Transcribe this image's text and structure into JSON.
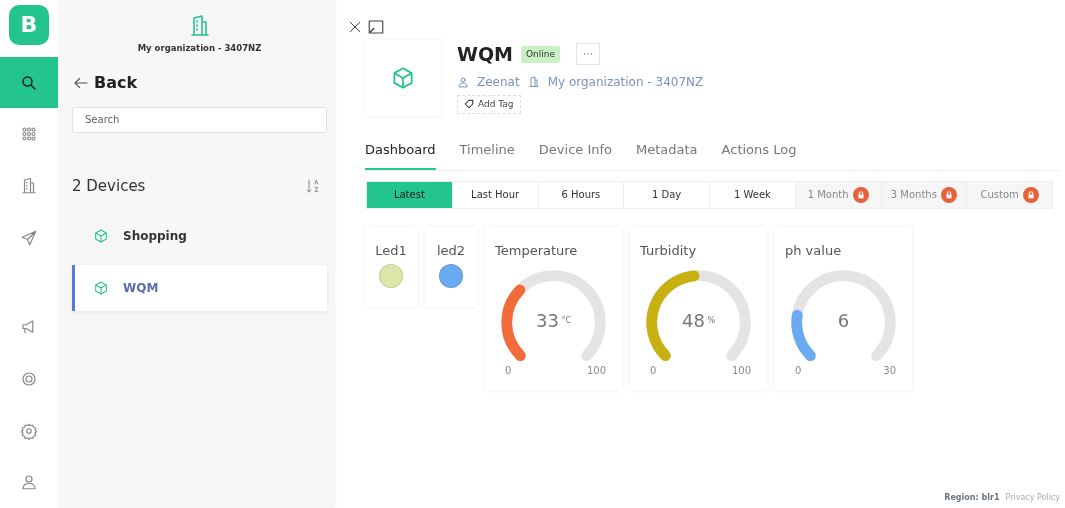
{
  "logo": {
    "letter": "B"
  },
  "rail": [
    {
      "kind": "search",
      "selected": true
    },
    {
      "kind": "grid",
      "selected": false
    },
    {
      "kind": "building",
      "selected": false
    },
    {
      "kind": "send",
      "selected": false
    },
    {
      "kind": "megaphone",
      "selected": false
    },
    {
      "kind": "lifebuoy",
      "selected": false
    },
    {
      "kind": "gear",
      "selected": false
    },
    {
      "kind": "user",
      "selected": false
    }
  ],
  "sidebar": {
    "organization": "My organization - 3407NZ",
    "back": "Back",
    "search": {
      "placeholder": "Search"
    },
    "count": "2 Devices",
    "devices": [
      {
        "name": "Shopping",
        "selected": false
      },
      {
        "name": "WQM",
        "selected": true
      }
    ]
  },
  "device": {
    "name": "WQM",
    "status": "Online",
    "online": true,
    "owner": "Zeenat",
    "organization": "My organization - 3407NZ",
    "add_tag": "Add Tag"
  },
  "tabs": [
    {
      "label": "Dashboard",
      "selected": true
    },
    {
      "label": "Timeline",
      "selected": false
    },
    {
      "label": "Device Info",
      "selected": false
    },
    {
      "label": "Metadata",
      "selected": false
    },
    {
      "label": "Actions Log",
      "selected": false
    }
  ],
  "ranges": [
    {
      "label": "Latest",
      "selected": true,
      "locked": false
    },
    {
      "label": "Last Hour",
      "selected": false,
      "locked": false
    },
    {
      "label": "6 Hours",
      "selected": false,
      "locked": false
    },
    {
      "label": "1 Day",
      "selected": false,
      "locked": false
    },
    {
      "label": "1 Week",
      "selected": false,
      "locked": false
    },
    {
      "label": "1 Month",
      "selected": false,
      "locked": true
    },
    {
      "label": "3 Months",
      "selected": false,
      "locked": true
    },
    {
      "label": "Custom",
      "selected": false,
      "locked": true
    }
  ],
  "widgets": [
    {
      "kind": "led",
      "title": "Led1",
      "color": "#dde5a8"
    },
    {
      "kind": "led",
      "title": "led2",
      "color": "#6aaaf0"
    },
    {
      "kind": "gauge",
      "title": "Temperature",
      "value": "33",
      "unit": "°C",
      "min": "0",
      "max": "100",
      "color": "#f26b3a"
    },
    {
      "kind": "gauge",
      "title": "Turbidity",
      "value": "48",
      "unit": "%",
      "min": "0",
      "max": "100",
      "color": "#c8b010"
    },
    {
      "kind": "gauge",
      "title": "ph value",
      "value": "6",
      "min": "0",
      "max": "30",
      "color": "#6aaaf0"
    }
  ],
  "footer": {
    "region": "Region: blr1",
    "privacy": "Privacy Policy"
  }
}
